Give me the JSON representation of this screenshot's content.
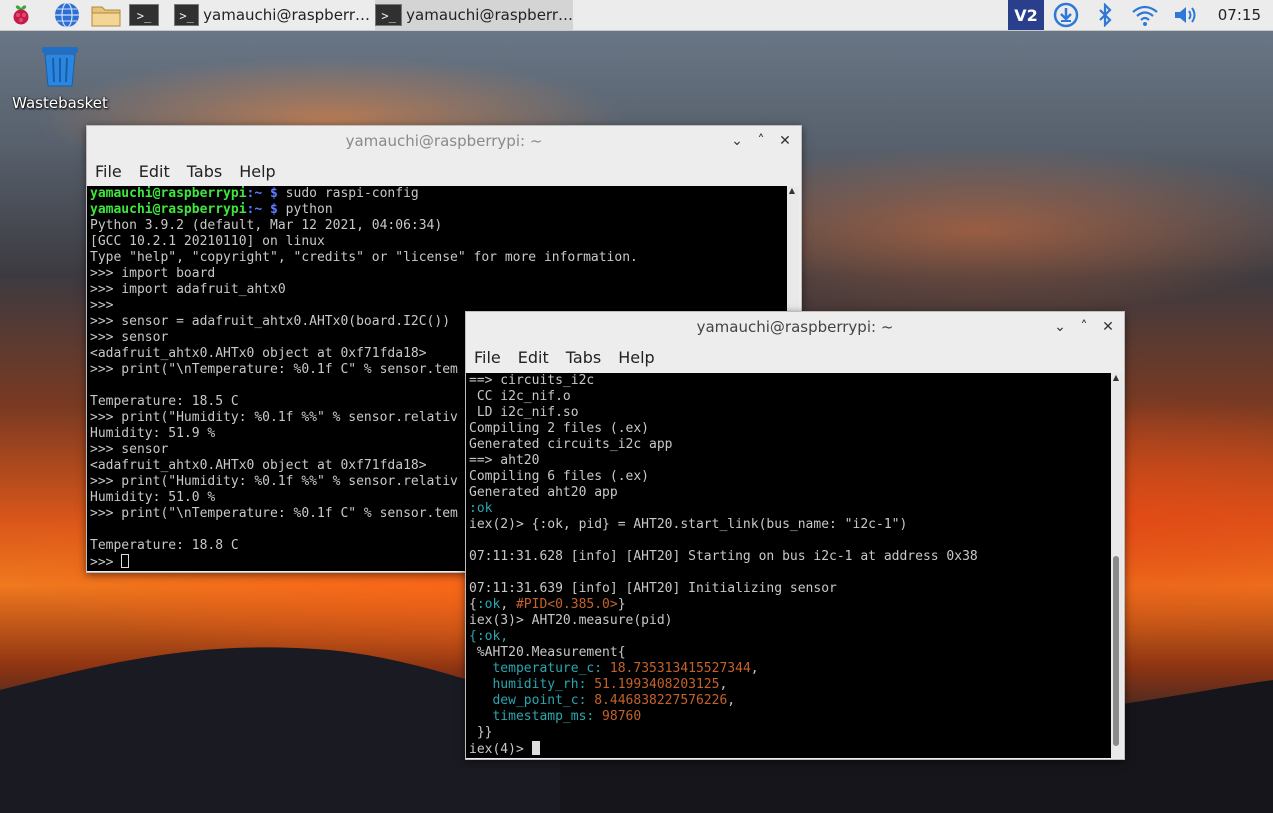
{
  "taskbar": {
    "icons": {
      "raspberry": "raspberry-menu-icon",
      "browser": "globe-browser-icon",
      "files": "folder-icon",
      "terminal": "terminal-icon"
    },
    "windows": [
      {
        "label": "yamauchi@raspberr…"
      },
      {
        "label": "yamauchi@raspberr…"
      }
    ],
    "tray": {
      "vnc": "vnc-icon",
      "update": "download-update-icon",
      "bluetooth": "bluetooth-icon",
      "wifi": "wifi-icon",
      "volume": "volume-icon"
    },
    "clock": "07:15"
  },
  "desktop": {
    "wastebasket_label": "Wastebasket"
  },
  "colors": {
    "prompt_green": "#3ee63e",
    "prompt_blue": "#5d7cff",
    "elixir_cyan": "#2aa6b0",
    "elixir_orange": "#c5622a",
    "wallpaper_sky": "#d9561a"
  },
  "window1": {
    "title": "yamauchi@raspberrypi: ~",
    "controls": {
      "minimize": "⌄",
      "maximize": "˄",
      "close": "✕"
    },
    "menu": [
      "File",
      "Edit",
      "Tabs",
      "Help"
    ],
    "prompt_user": "yamauchi@raspberrypi",
    "prompt_path": ":~ $",
    "cmd1": " sudo raspi-config",
    "cmd2": " python",
    "lines": [
      "Python 3.9.2 (default, Mar 12 2021, 04:06:34)",
      "[GCC 10.2.1 20210110] on linux",
      "Type \"help\", \"copyright\", \"credits\" or \"license\" for more information.",
      ">>> import board",
      ">>> import adafruit_ahtx0",
      ">>>",
      ">>> sensor = adafruit_ahtx0.AHTx0(board.I2C())",
      ">>> sensor",
      "<adafruit_ahtx0.AHTx0 object at 0xf71fda18>",
      ">>> print(\"\\nTemperature: %0.1f C\" % sensor.tem",
      "",
      "Temperature: 18.5 C",
      ">>> print(\"Humidity: %0.1f %%\" % sensor.relativ",
      "Humidity: 51.9 %",
      ">>> sensor",
      "<adafruit_ahtx0.AHTx0 object at 0xf71fda18>",
      ">>> print(\"Humidity: %0.1f %%\" % sensor.relativ",
      "Humidity: 51.0 %",
      ">>> print(\"\\nTemperature: %0.1f C\" % sensor.tem",
      "",
      "Temperature: 18.8 C"
    ],
    "last_prompt": ">>> "
  },
  "window2": {
    "title": "yamauchi@raspberrypi: ~",
    "controls": {
      "minimize": "⌄",
      "maximize": "˄",
      "close": "✕"
    },
    "menu": [
      "File",
      "Edit",
      "Tabs",
      "Help"
    ],
    "lines": [
      "==> circuits_i2c",
      " CC i2c_nif.o",
      " LD i2c_nif.so",
      "Compiling 2 files (.ex)",
      "Generated circuits_i2c app",
      "==> aht20",
      "Compiling 6 files (.ex)",
      "Generated aht20 app"
    ],
    "ok_atom": ":ok",
    "iex2": "iex(2)> {:ok, pid} = AHT20.start_link(bus_name: \"i2c-1\")",
    "log1": "07:11:31.628 [info] [AHT20] Starting on bus i2c-1 at address 0x38",
    "log2": "07:11:31.639 [info] [AHT20] Initializing sensor",
    "result_open": "{",
    "result_ok": ":ok",
    "result_sep": ", ",
    "result_pid": "#PID<0.385.0>",
    "result_close": "}",
    "iex3": "iex(3)> AHT20.measure(pid)",
    "measure_ok": "{:ok,",
    "struct_open": " %AHT20.Measurement{",
    "fields": [
      {
        "key": "   temperature_c:",
        "value": " 18.735313415527344",
        "sep": ","
      },
      {
        "key": "   humidity_rh:",
        "value": " 51.1993408203125",
        "sep": ","
      },
      {
        "key": "   dew_point_c:",
        "value": " 8.446838227576226",
        "sep": ","
      },
      {
        "key": "   timestamp_ms:",
        "value": " 98760",
        "sep": ""
      }
    ],
    "struct_close": " }}",
    "iex4": "iex(4)> "
  }
}
